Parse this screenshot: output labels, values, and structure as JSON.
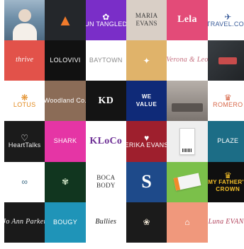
{
  "tiles": [
    {
      "id": "t01",
      "bg": "#6f8fa8",
      "fg": "#ffffff",
      "mark": "",
      "l1": "",
      "l2": "",
      "kind": "photo-woman"
    },
    {
      "id": "t02",
      "bg": "#24272b",
      "fg": "#f07a2b",
      "mark": "▲",
      "l1": "",
      "l2": "",
      "kind": "triangle"
    },
    {
      "id": "t03",
      "bg": "#7a2ec8",
      "fg": "#ffffff",
      "mark": "✿",
      "l1": "UN TANGLED",
      "l2": "",
      "kind": "text"
    },
    {
      "id": "t04",
      "bg": "#d9cfc6",
      "fg": "#3b3b3b",
      "mark": "",
      "l1": "MARIA",
      "l2": "EVANS",
      "kind": "two-serif"
    },
    {
      "id": "t05",
      "bg": "#e34b78",
      "fg": "#ffffff",
      "mark": "",
      "l1": "Lela",
      "l2": "",
      "kind": "big-serif"
    },
    {
      "id": "t06",
      "bg": "#ffffff",
      "fg": "#3a5c9a",
      "mark": "✈",
      "l1": "TRAVEL.COM",
      "l2": "",
      "kind": "text"
    },
    {
      "id": "t07",
      "bg": "#e2524a",
      "fg": "#ffffff",
      "mark": "",
      "l1": "thrive",
      "l2": "",
      "kind": "script"
    },
    {
      "id": "t08",
      "bg": "#111111",
      "fg": "#ffffff",
      "mark": "",
      "l1": "LOLOVIVI",
      "l2": "",
      "kind": "text"
    },
    {
      "id": "t09",
      "bg": "#ffffff",
      "fg": "#8a8a8a",
      "mark": "",
      "l1": "BAYTOWN",
      "l2": "",
      "kind": "text"
    },
    {
      "id": "t10",
      "bg": "#e0b36a",
      "fg": "#ffffff",
      "mark": "✦",
      "l1": "",
      "l2": "",
      "kind": "text"
    },
    {
      "id": "t11",
      "bg": "#ffffff",
      "fg": "#c56f7f",
      "mark": "",
      "l1": "Verona & Leo",
      "l2": "",
      "kind": "script"
    },
    {
      "id": "t12",
      "bg": "#2a2d30",
      "fg": "#e05a5a",
      "mark": "",
      "l1": "",
      "l2": "",
      "kind": "photo-dark"
    },
    {
      "id": "t13",
      "bg": "#ffffff",
      "fg": "#e1881b",
      "mark": "❋",
      "l1": "LOTUS",
      "l2": "",
      "kind": "lotus"
    },
    {
      "id": "t14",
      "bg": "#8b6c57",
      "fg": "#ffffff",
      "mark": "",
      "l1": "Woodland Co.",
      "l2": "",
      "kind": "text"
    },
    {
      "id": "t15",
      "bg": "#141414",
      "fg": "#ffffff",
      "mark": "",
      "l1": "KD",
      "l2": "",
      "kind": "big-serif"
    },
    {
      "id": "t16",
      "bg": "#0f2a78",
      "fg": "#ffffff",
      "mark": "",
      "l1": "WE",
      "l2": "VALUE",
      "kind": "two-bold"
    },
    {
      "id": "t17",
      "bg": "#8f8a85",
      "fg": "#ffffff",
      "mark": "",
      "l1": "",
      "l2": "",
      "kind": "photo-office"
    },
    {
      "id": "t18",
      "bg": "#ffffff",
      "fg": "#d86a4c",
      "mark": "♛",
      "l1": "ROMERO",
      "l2": "",
      "kind": "crest"
    },
    {
      "id": "t19",
      "bg": "#1b1b1b",
      "fg": "#f2f2f2",
      "mark": "♡",
      "l1": "HeartTalks",
      "l2": "",
      "kind": "text"
    },
    {
      "id": "t20",
      "bg": "#e535a5",
      "fg": "#ffffff",
      "mark": "",
      "l1": "SHARK",
      "l2": "",
      "kind": "shark"
    },
    {
      "id": "t21",
      "bg": "#ffffff",
      "fg": "#6d2f95",
      "mark": "",
      "l1": "KLoCo",
      "l2": "",
      "kind": "big-serif"
    },
    {
      "id": "t22",
      "bg": "#9e1f2d",
      "fg": "#ffffff",
      "mark": "♥",
      "l1": "ERIKA EVANS",
      "l2": "",
      "kind": "text"
    },
    {
      "id": "t23",
      "bg": "#eeeeee",
      "fg": "#222222",
      "mark": "",
      "l1": "",
      "l2": "",
      "kind": "ticket"
    },
    {
      "id": "t24",
      "bg": "#1c6d86",
      "fg": "#ffffff",
      "mark": "",
      "l1": "PLAZE",
      "l2": "",
      "kind": "text"
    },
    {
      "id": "t25",
      "bg": "#ffffff",
      "fg": "#3b6a84",
      "mark": "∞",
      "l1": "",
      "l2": "",
      "kind": "text"
    },
    {
      "id": "t26",
      "bg": "#11361f",
      "fg": "#cfe3c5",
      "mark": "✾",
      "l1": "",
      "l2": "",
      "kind": "leaf"
    },
    {
      "id": "t27",
      "bg": "#ffffff",
      "fg": "#333333",
      "mark": "",
      "l1": "BOCA",
      "l2": "BODY",
      "kind": "two-serif"
    },
    {
      "id": "t28",
      "bg": "#1e4a8a",
      "fg": "#ffffff",
      "mark": "S",
      "l1": "",
      "l2": "",
      "kind": "monogram"
    },
    {
      "id": "t29",
      "bg": "#7bc04a",
      "fg": "#f08a2a",
      "mark": "",
      "l1": "",
      "l2": "",
      "kind": "card"
    },
    {
      "id": "t30",
      "bg": "#0f0f0f",
      "fg": "#f4c02a",
      "mark": "♛",
      "l1": "MY FATHER'S",
      "l2": "CROWN",
      "kind": "two-bold"
    },
    {
      "id": "t31",
      "bg": "#1a1a1a",
      "fg": "#f5f5f5",
      "mark": "",
      "l1": "Jo Ann Parker",
      "l2": "",
      "kind": "script"
    },
    {
      "id": "t32",
      "bg": "#1f94b8",
      "fg": "#ffffff",
      "mark": "",
      "l1": "BOUGY",
      "l2": "",
      "kind": "text"
    },
    {
      "id": "t33",
      "bg": "#ffffff",
      "fg": "#111111",
      "mark": "",
      "l1": "Bullies",
      "l2": "",
      "kind": "script"
    },
    {
      "id": "t34",
      "bg": "#1b1b1b",
      "fg": "#e9e0cf",
      "mark": "❀",
      "l1": "",
      "l2": "",
      "kind": "text"
    },
    {
      "id": "t35",
      "bg": "#f0987c",
      "fg": "#ffffff",
      "mark": "⌂",
      "l1": "",
      "l2": "",
      "kind": "text"
    },
    {
      "id": "t36",
      "bg": "#ffffff",
      "fg": "#b0405a",
      "mark": "",
      "l1": "Luna EVANS",
      "l2": "",
      "kind": "script"
    }
  ]
}
